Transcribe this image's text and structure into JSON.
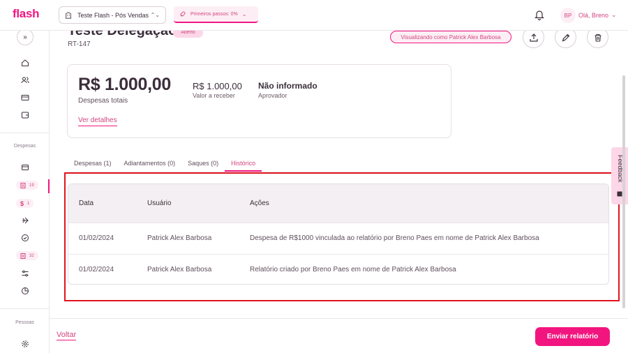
{
  "app": {
    "logo": "flash"
  },
  "topbar": {
    "company": "Teste Flash - Pós Vendas",
    "first_steps": "Primeiros passos: 0%",
    "avatar_initials": "BP",
    "greeting": "Olá, Breno"
  },
  "sidebar": {
    "sections": {
      "expenses": "Despesas",
      "people": "Pessoas"
    },
    "badges": {
      "reports": "19",
      "advances": "1",
      "approvals": "32"
    }
  },
  "report": {
    "title": "Teste Delegação",
    "status": "Aberto",
    "code": "RT-147",
    "viewing_as": "Visualizando como Patrick Alex Barbosa"
  },
  "summary": {
    "total_value": "R$ 1.000,00",
    "total_label": "Despesas totais",
    "receive_value": "R$ 1.000,00",
    "receive_label": "Valor a receber",
    "approver_value": "Não informado",
    "approver_label": "Aprovador",
    "details_link": "Ver detalhes"
  },
  "tabs": [
    {
      "label": "Despesas (1)"
    },
    {
      "label": "Adiantamentos (0)"
    },
    {
      "label": "Saques (0)"
    },
    {
      "label": "Histórico",
      "active": true
    }
  ],
  "history": {
    "columns": [
      "Data",
      "Usuário",
      "Ações"
    ],
    "rows": [
      {
        "date": "01/02/2024",
        "user": "Patrick Alex Barbosa",
        "action": "Despesa de R$1000 vinculada ao relatório por Breno Paes em nome de Patrick Alex Barbosa"
      },
      {
        "date": "01/02/2024",
        "user": "Patrick Alex Barbosa",
        "action": "Relatório criado por Breno Paes em nome de Patrick Alex Barbosa"
      }
    ]
  },
  "feedback": {
    "label": "Feedback"
  },
  "footer": {
    "back": "Voltar",
    "submit": "Enviar relatório"
  },
  "colors": {
    "brand": "#f2157f",
    "brand_text": "#d1467f",
    "highlight": "#e0141f"
  }
}
